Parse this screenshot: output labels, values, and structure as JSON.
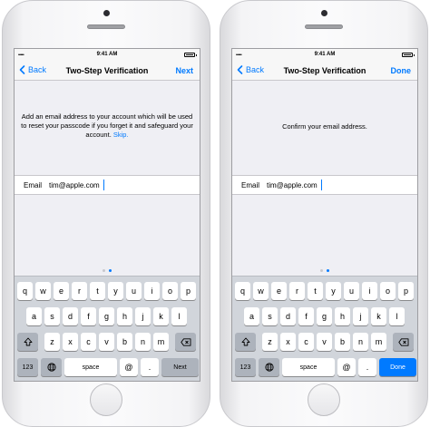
{
  "status_bar": {
    "signal": "•••••",
    "wifi": "wifi",
    "time": "9:41 AM"
  },
  "screens": [
    {
      "back_label": "Back",
      "title": "Two-Step Verification",
      "action_label": "Next",
      "instruction": "Add an email address to your account which will be used to reset your passcode if you forget it and safeguard your account.",
      "skip_label": "Skip.",
      "email_label": "Email",
      "email_value": "tim@apple.com",
      "return_key": "Next"
    },
    {
      "back_label": "Back",
      "title": "Two-Step Verification",
      "action_label": "Done",
      "instruction": "Confirm your email address.",
      "email_label": "Email",
      "email_value": "tim@apple.com",
      "return_key": "Done"
    }
  ],
  "keyboard": {
    "row1": [
      "q",
      "w",
      "e",
      "r",
      "t",
      "y",
      "u",
      "i",
      "o",
      "p"
    ],
    "row2": [
      "a",
      "s",
      "d",
      "f",
      "g",
      "h",
      "j",
      "k",
      "l"
    ],
    "row3": [
      "z",
      "x",
      "c",
      "v",
      "b",
      "n",
      "m"
    ],
    "numbers_key": "123",
    "space_key": "space",
    "at_key": "@",
    "dot_key": "."
  },
  "colors": {
    "accent": "#007aff",
    "keyboard_bg": "#d1d5db",
    "screen_bg": "#efeff4"
  },
  "icons": [
    "chevron-left-icon",
    "shift-icon",
    "backspace-icon",
    "globe-icon",
    "battery-icon",
    "signal-icon"
  ]
}
